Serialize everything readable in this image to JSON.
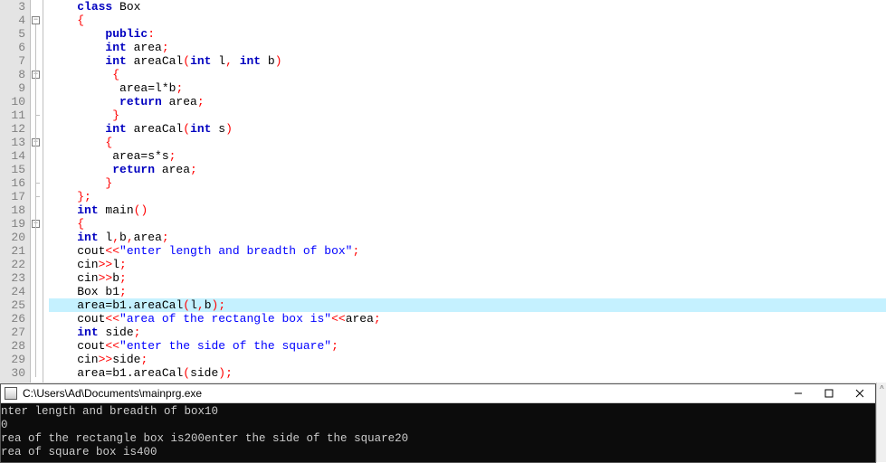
{
  "gutter": {
    "start": 3,
    "end": 30
  },
  "highlight_line": 25,
  "fold_boxes": [
    4,
    8,
    13,
    19
  ],
  "code": {
    "3": [
      {
        "t": "    ",
        "c": ""
      },
      {
        "t": "class",
        "c": "kw"
      },
      {
        "t": " Box",
        "c": "ident"
      }
    ],
    "4": [
      {
        "t": "    ",
        "c": ""
      },
      {
        "t": "{",
        "c": "punct"
      }
    ],
    "5": [
      {
        "t": "        ",
        "c": ""
      },
      {
        "t": "public",
        "c": "kw"
      },
      {
        "t": ":",
        "c": "punct"
      }
    ],
    "6": [
      {
        "t": "        ",
        "c": ""
      },
      {
        "t": "int",
        "c": "kw"
      },
      {
        "t": " area",
        "c": "ident"
      },
      {
        "t": ";",
        "c": "punct"
      }
    ],
    "7": [
      {
        "t": "        ",
        "c": ""
      },
      {
        "t": "int",
        "c": "kw"
      },
      {
        "t": " areaCal",
        "c": "ident"
      },
      {
        "t": "(",
        "c": "punct"
      },
      {
        "t": "int",
        "c": "kw"
      },
      {
        "t": " l",
        "c": "ident"
      },
      {
        "t": ",",
        "c": "punct"
      },
      {
        "t": " ",
        "c": ""
      },
      {
        "t": "int",
        "c": "kw"
      },
      {
        "t": " b",
        "c": "ident"
      },
      {
        "t": ")",
        "c": "punct"
      }
    ],
    "8": [
      {
        "t": "         ",
        "c": ""
      },
      {
        "t": "{",
        "c": "punct"
      }
    ],
    "9": [
      {
        "t": "          area",
        "c": "ident"
      },
      {
        "t": "=",
        "c": "op"
      },
      {
        "t": "l",
        "c": "ident"
      },
      {
        "t": "*",
        "c": "op"
      },
      {
        "t": "b",
        "c": "ident"
      },
      {
        "t": ";",
        "c": "punct"
      }
    ],
    "10": [
      {
        "t": "          ",
        "c": ""
      },
      {
        "t": "return",
        "c": "kw"
      },
      {
        "t": " area",
        "c": "ident"
      },
      {
        "t": ";",
        "c": "punct"
      }
    ],
    "11": [
      {
        "t": "         ",
        "c": ""
      },
      {
        "t": "}",
        "c": "punct"
      }
    ],
    "12": [
      {
        "t": "        ",
        "c": ""
      },
      {
        "t": "int",
        "c": "kw"
      },
      {
        "t": " areaCal",
        "c": "ident"
      },
      {
        "t": "(",
        "c": "punct"
      },
      {
        "t": "int",
        "c": "kw"
      },
      {
        "t": " s",
        "c": "ident"
      },
      {
        "t": ")",
        "c": "punct"
      }
    ],
    "13": [
      {
        "t": "        ",
        "c": ""
      },
      {
        "t": "{",
        "c": "punct"
      }
    ],
    "14": [
      {
        "t": "         area",
        "c": "ident"
      },
      {
        "t": "=",
        "c": "op"
      },
      {
        "t": "s",
        "c": "ident"
      },
      {
        "t": "*",
        "c": "op"
      },
      {
        "t": "s",
        "c": "ident"
      },
      {
        "t": ";",
        "c": "punct"
      }
    ],
    "15": [
      {
        "t": "         ",
        "c": ""
      },
      {
        "t": "return",
        "c": "kw"
      },
      {
        "t": " area",
        "c": "ident"
      },
      {
        "t": ";",
        "c": "punct"
      }
    ],
    "16": [
      {
        "t": "        ",
        "c": ""
      },
      {
        "t": "}",
        "c": "punct"
      }
    ],
    "17": [
      {
        "t": "    ",
        "c": ""
      },
      {
        "t": "};",
        "c": "punct"
      }
    ],
    "18": [
      {
        "t": "    ",
        "c": ""
      },
      {
        "t": "int",
        "c": "kw"
      },
      {
        "t": " main",
        "c": "ident"
      },
      {
        "t": "()",
        "c": "punct"
      }
    ],
    "19": [
      {
        "t": "    ",
        "c": ""
      },
      {
        "t": "{",
        "c": "punct"
      }
    ],
    "20": [
      {
        "t": "    ",
        "c": ""
      },
      {
        "t": "int",
        "c": "kw"
      },
      {
        "t": " l",
        "c": "ident"
      },
      {
        "t": ",",
        "c": "punct"
      },
      {
        "t": "b",
        "c": "ident"
      },
      {
        "t": ",",
        "c": "punct"
      },
      {
        "t": "area",
        "c": "ident"
      },
      {
        "t": ";",
        "c": "punct"
      }
    ],
    "21": [
      {
        "t": "    cout",
        "c": "ident"
      },
      {
        "t": "<<",
        "c": "punct"
      },
      {
        "t": "\"enter length and breadth of box\"",
        "c": "str"
      },
      {
        "t": ";",
        "c": "punct"
      }
    ],
    "22": [
      {
        "t": "    cin",
        "c": "ident"
      },
      {
        "t": ">>",
        "c": "punct"
      },
      {
        "t": "l",
        "c": "ident"
      },
      {
        "t": ";",
        "c": "punct"
      }
    ],
    "23": [
      {
        "t": "    cin",
        "c": "ident"
      },
      {
        "t": ">>",
        "c": "punct"
      },
      {
        "t": "b",
        "c": "ident"
      },
      {
        "t": ";",
        "c": "punct"
      }
    ],
    "24": [
      {
        "t": "    Box b1",
        "c": "ident"
      },
      {
        "t": ";",
        "c": "punct"
      }
    ],
    "25": [
      {
        "t": "    area",
        "c": "ident"
      },
      {
        "t": "=",
        "c": "op"
      },
      {
        "t": "b1",
        "c": "ident"
      },
      {
        "t": ".",
        "c": "op"
      },
      {
        "t": "areaCal",
        "c": "ident"
      },
      {
        "t": "(",
        "c": "punct"
      },
      {
        "t": "l",
        "c": "ident"
      },
      {
        "t": ",",
        "c": "punct"
      },
      {
        "t": "b",
        "c": "ident"
      },
      {
        "t": ");",
        "c": "punct"
      }
    ],
    "26": [
      {
        "t": "    cout",
        "c": "ident"
      },
      {
        "t": "<<",
        "c": "punct"
      },
      {
        "t": "\"area of the rectangle box is\"",
        "c": "str"
      },
      {
        "t": "<<",
        "c": "punct"
      },
      {
        "t": "area",
        "c": "ident"
      },
      {
        "t": ";",
        "c": "punct"
      }
    ],
    "27": [
      {
        "t": "    ",
        "c": ""
      },
      {
        "t": "int",
        "c": "kw"
      },
      {
        "t": " side",
        "c": "ident"
      },
      {
        "t": ";",
        "c": "punct"
      }
    ],
    "28": [
      {
        "t": "    cout",
        "c": "ident"
      },
      {
        "t": "<<",
        "c": "punct"
      },
      {
        "t": "\"enter the side of the square\"",
        "c": "str"
      },
      {
        "t": ";",
        "c": "punct"
      }
    ],
    "29": [
      {
        "t": "    cin",
        "c": "ident"
      },
      {
        "t": ">>",
        "c": "punct"
      },
      {
        "t": "side",
        "c": "ident"
      },
      {
        "t": ";",
        "c": "punct"
      }
    ],
    "30": [
      {
        "t": "    area",
        "c": "ident"
      },
      {
        "t": "=",
        "c": "op"
      },
      {
        "t": "b1",
        "c": "ident"
      },
      {
        "t": ".",
        "c": "op"
      },
      {
        "t": "areaCal",
        "c": "ident"
      },
      {
        "t": "(",
        "c": "punct"
      },
      {
        "t": "side",
        "c": "ident"
      },
      {
        "t": ");",
        "c": "punct"
      }
    ]
  },
  "console": {
    "title": "C:\\Users\\Ad\\Documents\\mainprg.exe",
    "lines": [
      "nter length and breadth of box10",
      "0",
      "rea of the rectangle box is200enter the side of the square20",
      "rea of square box is400"
    ]
  }
}
